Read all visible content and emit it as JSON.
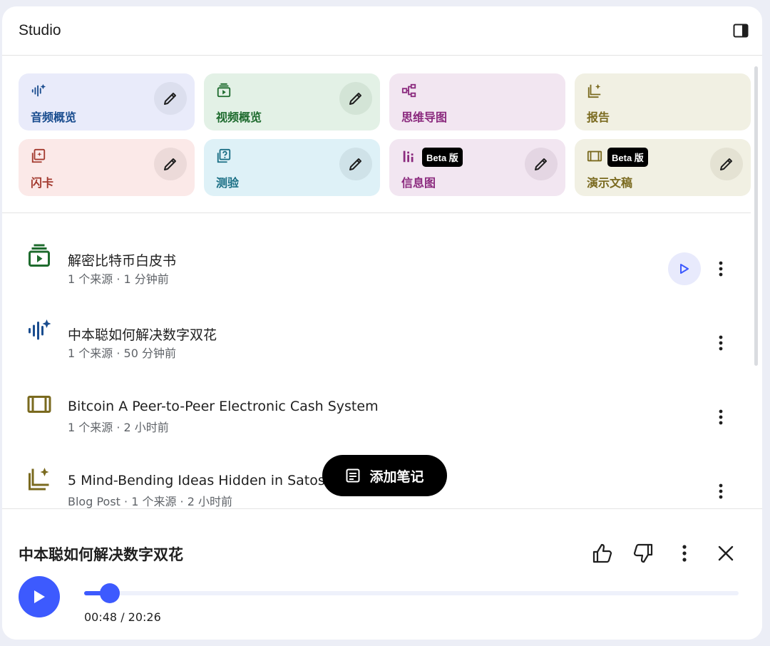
{
  "panel": {
    "title": "Studio"
  },
  "tiles": [
    {
      "label": "音频概览",
      "icon": "audio-sparkle-icon",
      "bg": "#e9ebfa",
      "fg": "#1a4d8f",
      "edit_bg": "#dcdfee",
      "editable": true
    },
    {
      "label": "视频概览",
      "icon": "video-icon",
      "bg": "#e3f1e6",
      "fg": "#1e6b2e",
      "edit_bg": "#d3e4d6",
      "editable": true
    },
    {
      "label": "思维导图",
      "icon": "mindmap-icon",
      "bg": "#f2e6f1",
      "fg": "#8b2a7e",
      "edit_bg": "#e4d6e3",
      "editable": false
    },
    {
      "label": "报告",
      "icon": "report-icon",
      "bg": "#f1f0e3",
      "fg": "#7a6a1f",
      "edit_bg": "#e4e2d3",
      "editable": false
    },
    {
      "label": "闪卡",
      "icon": "flashcard-icon",
      "bg": "#fbe9e8",
      "fg": "#a33a2f",
      "edit_bg": "#ecdad9",
      "editable": true
    },
    {
      "label": "测验",
      "icon": "quiz-icon",
      "bg": "#def1f7",
      "fg": "#1a6f85",
      "edit_bg": "#cfe2e8",
      "editable": true
    },
    {
      "label": "信息图",
      "icon": "infographic-icon",
      "bg": "#f2e6f1",
      "fg": "#8b2a7e",
      "edit_bg": "#e4d6e3",
      "editable": true,
      "badge": "Beta 版"
    },
    {
      "label": "演示文稿",
      "icon": "slides-icon",
      "bg": "#f1f0e3",
      "fg": "#7a6a1f",
      "edit_bg": "#e4e2d3",
      "editable": true,
      "badge": "Beta 版"
    }
  ],
  "items": [
    {
      "title": "解密比特币白皮书",
      "meta": "1 个来源 · 1 分钟前",
      "icon": "video-icon",
      "icon_color": "#1e6b2e",
      "playable": true
    },
    {
      "title": "中本聪如何解决数字双花",
      "meta": "1 个来源 · 50 分钟前",
      "icon": "audio-sparkle-icon",
      "icon_color": "#1a4d8f",
      "playable": false
    },
    {
      "title": "Bitcoin A Peer-to-Peer Electronic Cash System",
      "meta": "1 个来源 · 2 小时前",
      "icon": "slides-icon",
      "icon_color": "#7a6a1f",
      "playable": false
    },
    {
      "title": "5 Mind-Bending Ideas Hidden in Satoshi’s Bitcoin Paper",
      "meta": "Blog Post · 1 个来源 · 2 小时前",
      "icon": "report-icon",
      "icon_color": "#7a6a1f",
      "playable": false
    }
  ],
  "add_note": {
    "label": "添加笔记"
  },
  "player": {
    "title": "中本聪如何解决数字双花",
    "time_text": "00:48 / 20:26",
    "progress_fraction": 0.039
  },
  "colors": {
    "accent": "#3d5afe"
  }
}
